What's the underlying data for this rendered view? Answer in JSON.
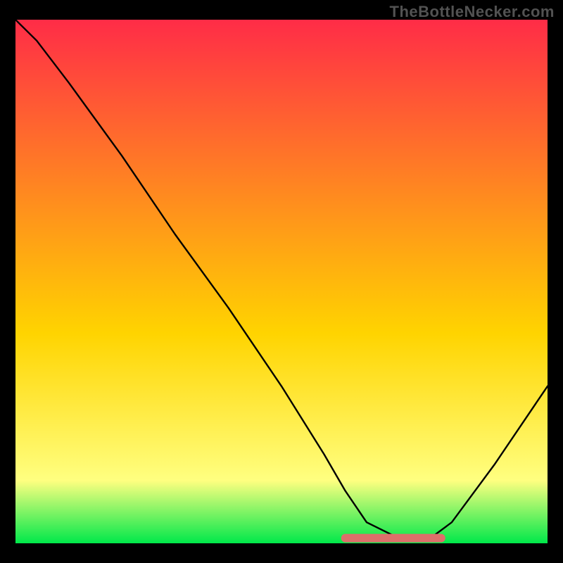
{
  "watermark": "TheBottleNecker.com",
  "colors": {
    "frame": "#000000",
    "top": "#ff2c47",
    "mid": "#ffd400",
    "band": "#ffff80",
    "bottom": "#00e84a",
    "curve": "#000000",
    "highlight": "#dd6f6a"
  },
  "chart_data": {
    "type": "line",
    "title": "",
    "xlabel": "",
    "ylabel": "",
    "xlim": [
      0,
      100
    ],
    "ylim": [
      0,
      100
    ],
    "series": [
      {
        "name": "curve",
        "x": [
          0,
          4,
          10,
          20,
          30,
          40,
          50,
          58,
          62,
          66,
          72,
          78,
          82,
          90,
          100
        ],
        "y": [
          100,
          96,
          88,
          74,
          59,
          45,
          30,
          17,
          10,
          4,
          1,
          1,
          4,
          15,
          30
        ]
      }
    ],
    "highlight_segment": {
      "x_start": 62,
      "x_end": 80,
      "y": 1
    }
  }
}
